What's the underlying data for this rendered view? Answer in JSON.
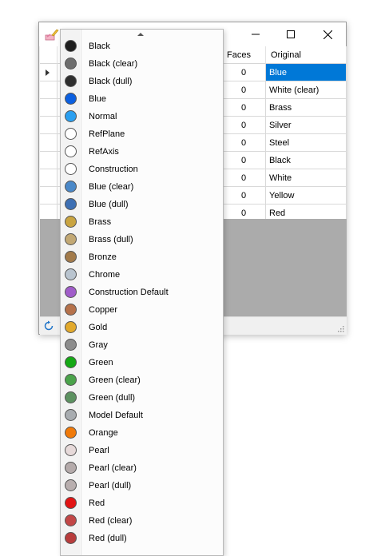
{
  "grid": {
    "headers": {
      "faces": "Faces",
      "original": "Original"
    },
    "rows": [
      {
        "faces": "0",
        "original": "Blue"
      },
      {
        "faces": "0",
        "original": "White (clear)"
      },
      {
        "faces": "0",
        "original": "Brass"
      },
      {
        "faces": "0",
        "original": "Silver"
      },
      {
        "faces": "0",
        "original": "Steel"
      },
      {
        "faces": "0",
        "original": "Black"
      },
      {
        "faces": "0",
        "original": "White"
      },
      {
        "faces": "0",
        "original": "Yellow"
      },
      {
        "faces": "0",
        "original": "Red"
      }
    ]
  },
  "dropdown": {
    "items": [
      {
        "label": "Black",
        "color": "#1e1e1e"
      },
      {
        "label": "Black (clear)",
        "color": "#6e6e6e"
      },
      {
        "label": "Black (dull)",
        "color": "#2e2e2e"
      },
      {
        "label": "Blue",
        "color": "#0a5fe0"
      },
      {
        "label": "Normal",
        "color": "#2a9ff0"
      },
      {
        "label": "RefPlane",
        "color": "#ffffff"
      },
      {
        "label": "RefAxis",
        "color": "#ffffff"
      },
      {
        "label": "Construction",
        "color": "#ffffff"
      },
      {
        "label": "Blue (clear)",
        "color": "#4a88c8"
      },
      {
        "label": "Blue (dull)",
        "color": "#3d6fb3"
      },
      {
        "label": "Brass",
        "color": "#c9a441"
      },
      {
        "label": "Brass (dull)",
        "color": "#c2a874"
      },
      {
        "label": "Bronze",
        "color": "#a27a4a"
      },
      {
        "label": "Chrome",
        "color": "#b9c4cf"
      },
      {
        "label": "Construction Default",
        "color": "#a05cc9"
      },
      {
        "label": "Copper",
        "color": "#b5714a"
      },
      {
        "label": "Gold",
        "color": "#e2a92c"
      },
      {
        "label": "Gray",
        "color": "#8c8c8c"
      },
      {
        "label": "Green",
        "color": "#14a814"
      },
      {
        "label": "Green (clear)",
        "color": "#4aa34a"
      },
      {
        "label": "Green (dull)",
        "color": "#5c9160"
      },
      {
        "label": "Model Default",
        "color": "#a8acb0"
      },
      {
        "label": "Orange",
        "color": "#f07a0a"
      },
      {
        "label": "Pearl",
        "color": "#e6d9d9"
      },
      {
        "label": "Pearl (clear)",
        "color": "#b4aaaa"
      },
      {
        "label": "Pearl (dull)",
        "color": "#b8aeae"
      },
      {
        "label": "Red",
        "color": "#e21414"
      },
      {
        "label": "Red (clear)",
        "color": "#c24646"
      },
      {
        "label": "Red (dull)",
        "color": "#b83c3c"
      }
    ]
  },
  "colors": {
    "selection": "#0078d7",
    "gridArea": "#ababab"
  }
}
